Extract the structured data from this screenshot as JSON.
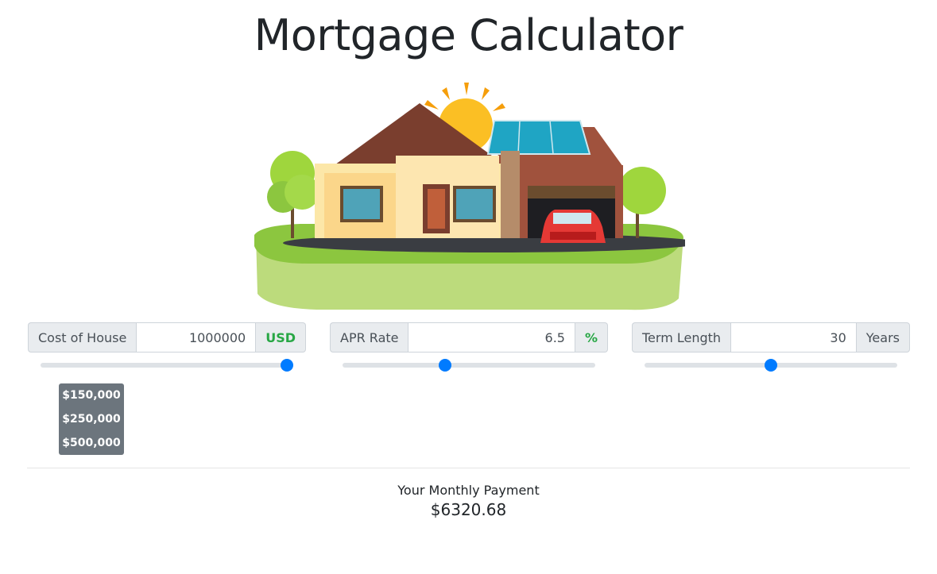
{
  "title": "Mortgage Calculator",
  "cost": {
    "label": "Cost of House",
    "value": "1000000",
    "unit": "USD",
    "slider_fraction": 1.0
  },
  "apr": {
    "label": "APR Rate",
    "value": "6.5",
    "unit": "%",
    "slider_fraction": 0.4
  },
  "term": {
    "label": "Term Length",
    "value": "30",
    "unit": "Years",
    "slider_fraction": 0.5
  },
  "presets": [
    "$150,000",
    "$250,000",
    "$500,000"
  ],
  "result": {
    "label": "Your Monthly Payment",
    "value": "$6320.68"
  },
  "colors": {
    "accent": "#007bff",
    "unit_green": "#28a745",
    "preset_bg": "#6c757d"
  }
}
